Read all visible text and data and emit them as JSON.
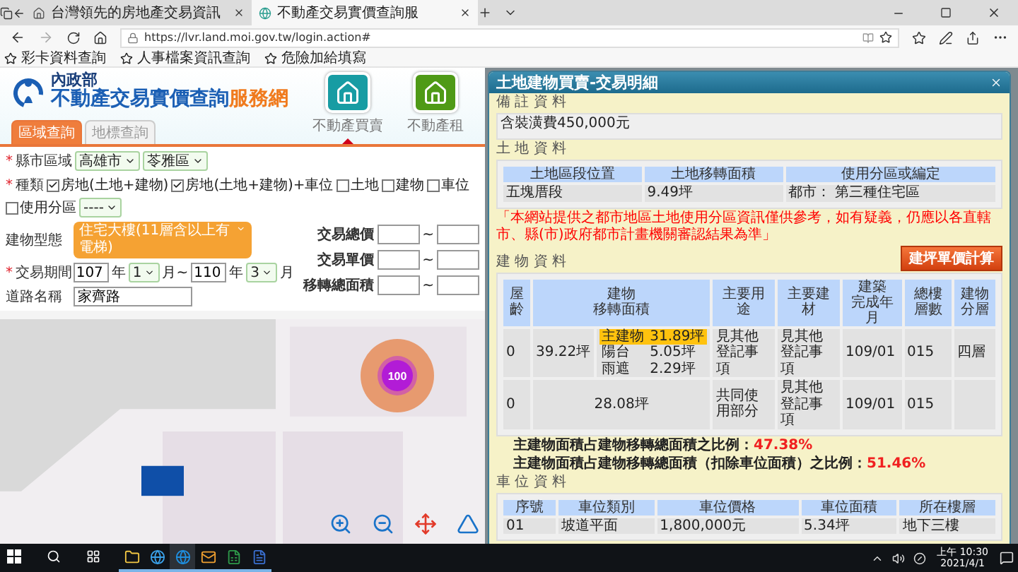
{
  "browser": {
    "tabs": [
      {
        "title": "台灣領先的房地產交易資訊",
        "selected": false
      },
      {
        "title": "不動產交易實價查詢服",
        "selected": true
      }
    ],
    "url": "https://lvr.land.moi.gov.tw/login.action#",
    "favorites": [
      "彩卡資料查詢",
      "人事檔案資訊查詢",
      "危險加給填寫"
    ]
  },
  "site": {
    "ministry": "內政部",
    "title": "不動產交易實價查詢",
    "title_accent": "服務網",
    "search_tabs": [
      {
        "label": "區域查詢",
        "selected": true
      },
      {
        "label": "地標查詢",
        "selected": false
      }
    ],
    "services": [
      {
        "label": "不動產買賣",
        "selected": true,
        "color": "#179ca3"
      },
      {
        "label": "不動產租",
        "selected": false,
        "color": "#4f9a16"
      }
    ]
  },
  "form": {
    "city": {
      "mark": "*",
      "label": "縣市區域",
      "selects": [
        "高雄市",
        "苓雅區"
      ]
    },
    "types": {
      "mark": "*",
      "label": "種類",
      "options": [
        {
          "label": "房地(土地+建物)",
          "checked": true
        },
        {
          "label": "房地(土地+建物)+車位",
          "checked": true
        },
        {
          "label": "土地",
          "checked": false
        },
        {
          "label": "建物",
          "checked": false
        },
        {
          "label": "車位",
          "checked": false
        },
        {
          "label": "使用分區",
          "checked": false
        }
      ],
      "zone_select": "----"
    },
    "building_type": {
      "label": "建物型態",
      "value": "住宅大樓(11層含以上有電梯)"
    },
    "period": {
      "mark": "*",
      "label": "交易期間",
      "parts": [
        {
          "kind": "input",
          "value": "107"
        },
        {
          "kind": "text",
          "value": "年"
        },
        {
          "kind": "select",
          "value": "1"
        },
        {
          "kind": "text",
          "value": "月~"
        },
        {
          "kind": "input",
          "value": "110"
        },
        {
          "kind": "text",
          "value": "年"
        },
        {
          "kind": "select",
          "value": "3"
        },
        {
          "kind": "text",
          "value": "月"
        }
      ]
    },
    "road": {
      "label": "道路名稱",
      "value": "家齊路"
    },
    "ranges": [
      {
        "label": "交易總價",
        "separator": "~"
      },
      {
        "label": "交易單價",
        "separator": "~"
      },
      {
        "label": "移轉總面積",
        "separator": "~"
      }
    ]
  },
  "map": {
    "cluster": {
      "count": "100"
    }
  },
  "dialog": {
    "title": "土地建物買賣-交易明細",
    "remarks": {
      "heading": "備 註 資 料",
      "text": "含裝潢費450,000元"
    },
    "land": {
      "heading": "土 地 資 料",
      "columns": [
        "土地區段位置",
        "土地移轉面積",
        "使用分區或編定"
      ],
      "rows": [
        [
          "五塊厝段",
          "9.49坪",
          "都市： 第三種住宅區"
        ]
      ]
    },
    "notice": "「本網站提供之都市地區土地使用分區資訊僅供參考，如有疑義，仍應以各直轄市、縣(市)政府都市計畫機關審認結果為準」",
    "calc_button": "建坪單價計算",
    "building": {
      "heading": "建 物 資 料",
      "columns": [
        {
          "lines": [
            "屋齡"
          ]
        },
        {
          "lines": [
            "建物",
            "移轉面積"
          ]
        },
        {
          "lines": [
            "主要用途"
          ]
        },
        {
          "lines": [
            "主要建材"
          ]
        },
        {
          "lines": [
            "建築",
            "完成年月"
          ]
        },
        {
          "lines": [
            "總樓層數"
          ]
        },
        {
          "lines": [
            "建物分層"
          ]
        }
      ],
      "rows": [
        {
          "age": "0",
          "total": "39.22坪",
          "parts": [
            {
              "name": "主建物",
              "area": "31.89坪",
              "highlighted": true
            },
            {
              "name": "陽台",
              "area": "5.05坪",
              "highlighted": false
            },
            {
              "name": "雨遮",
              "area": "2.29坪",
              "highlighted": false
            }
          ],
          "use": "見其他登記事項",
          "material": "見其他登記事項",
          "completed": "109/01",
          "floors": "015",
          "level": "四層"
        },
        {
          "age": "0",
          "total": "28.08坪",
          "use": "共同使用部分",
          "material": "見其他登記事項",
          "completed": "109/01",
          "floors": "015"
        }
      ]
    },
    "ratios": [
      {
        "label": "主建物面積占建物移轉總面積之比例：",
        "value": "47.38%"
      },
      {
        "label": "主建物面積占建物移轉總面積（扣除車位面積）之比例：",
        "value": "51.46%"
      }
    ],
    "parking": {
      "heading": "車 位 資 料",
      "columns": [
        "序號",
        "車位類別",
        "車位價格",
        "車位面積",
        "所在樓層"
      ],
      "rows": [
        [
          "01",
          "坡道平面",
          "1,800,000元",
          "5.34坪",
          "地下三樓"
        ]
      ]
    }
  },
  "taskbar": {
    "apps": [
      {
        "kind": "folder",
        "running": true,
        "selected": false
      },
      {
        "kind": "ie",
        "running": true,
        "selected": false
      },
      {
        "kind": "edge",
        "running": true,
        "selected": true
      },
      {
        "kind": "mail",
        "running": true,
        "selected": false
      },
      {
        "kind": "spreadsheet",
        "running": true,
        "selected": false
      },
      {
        "kind": "document",
        "running": true,
        "selected": false
      }
    ],
    "time": "上午 10:30",
    "date": "2021/4/1"
  }
}
